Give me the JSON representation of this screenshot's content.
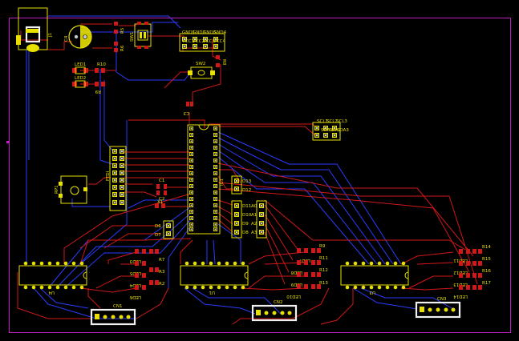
{
  "view": {
    "board_outline_color": "#c020c0",
    "top_copper_color": "#d01818",
    "bottom_copper_color": "#2a3cff",
    "silkscreen_color": "#e8e000",
    "background_color": "#000000"
  },
  "labels": {
    "j1": "J1",
    "c4": "C4",
    "sw1": "SW1",
    "r5": "R5",
    "r6": "R6",
    "gnd1": "GND1",
    "gnd2": "GND2",
    "gnd3": "GND3",
    "gnd4": "GND4",
    "vcc1": "VCC1",
    "vcc2": "VCC2",
    "vcc3": "VCC3",
    "vcc4": "VCC4",
    "led1": "LED1",
    "led2": "LED2",
    "r10": "R10",
    "r9": "R9",
    "sw2": "SW2",
    "r8": "R8",
    "c3": "C3",
    "scl1": "SCL1",
    "scl2": "SCL2",
    "scl3": "SCL3",
    "sda1": "SDA1",
    "sda2": "SDA2",
    "sda3": "SDA3",
    "ftdi": "FTDI",
    "rp1": "RP1",
    "c1": "C1",
    "c2": "C2",
    "x1": "X1",
    "ic1": "IC1",
    "d13": "D13",
    "d12": "D12",
    "d11": "D11",
    "d10": "D10",
    "d9": "D9",
    "d8": "D8",
    "a0": "A0",
    "a1": "A1",
    "a2": "A2",
    "a3": "A3",
    "d6": "D6",
    "d7": "D7",
    "led3": "LED3",
    "led5": "LED5",
    "led4": "LED4",
    "led6": "LED6",
    "r7": "R7",
    "r3": "R3",
    "r2": "R2",
    "u4": "U4",
    "cn1": "CN1",
    "led7": "LED7",
    "led8": "LED8",
    "led9": "LED9",
    "led10": "LED10",
    "r11": "R11",
    "r12": "R12",
    "r13": "R13",
    "u1": "U1",
    "cn2": "CN2",
    "led11": "LED11",
    "led12": "LED12",
    "led13": "LED13",
    "led14": "LED14",
    "r14": "R14",
    "r15": "R15",
    "r16": "R16",
    "r17": "R17",
    "u3": "U3",
    "cn3": "CN3"
  }
}
